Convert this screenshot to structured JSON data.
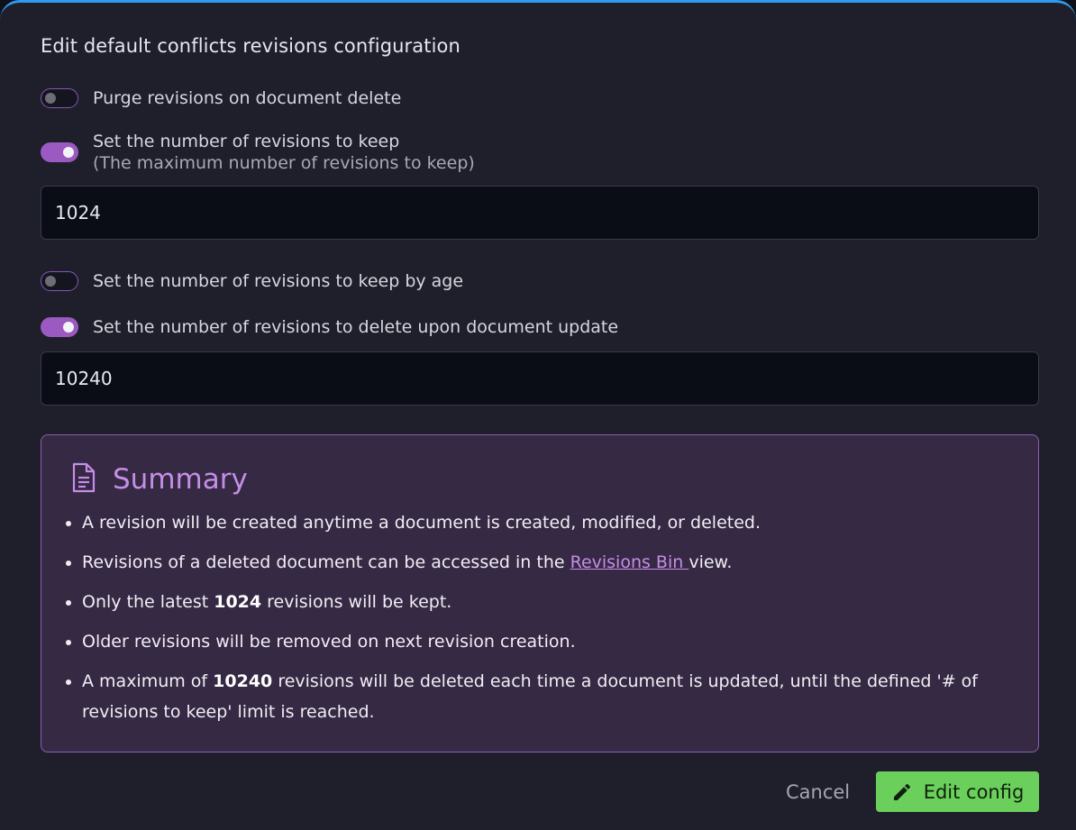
{
  "dialog": {
    "title": "Edit default conflicts revisions configuration"
  },
  "options": {
    "purge_on_delete": {
      "label": "Purge revisions on document delete",
      "enabled": false
    },
    "keep_count": {
      "label": "Set the number of revisions to keep",
      "sublabel": "(The maximum number of revisions to keep)",
      "enabled": true,
      "value": "1024"
    },
    "keep_by_age": {
      "label": "Set the number of revisions to keep by age",
      "enabled": false
    },
    "delete_on_update": {
      "label": "Set the number of revisions to delete upon document update",
      "enabled": true,
      "value": "10240"
    }
  },
  "summary": {
    "title": "Summary",
    "icon": "document-icon",
    "item1": "A revision will be created anytime a document is created, modified, or deleted.",
    "item2_before": "Revisions of a deleted document can be accessed in the ",
    "item2_link": "Revisions Bin ",
    "item2_after": "view.",
    "item3_before": "Only the latest ",
    "item3_value": "1024",
    "item3_after": " revisions will be kept.",
    "item4": "Older revisions will be removed on next revision creation.",
    "item5_before": "A maximum of ",
    "item5_value": "10240",
    "item5_after": " revisions will be deleted each time a document is updated, until the defined '# of revisions to keep' limit is reached."
  },
  "footer": {
    "cancel_label": "Cancel",
    "edit_label": "Edit config",
    "edit_icon": "pencil-icon"
  },
  "colors": {
    "accent": "#9b59c2",
    "top_border": "#2f9bf0",
    "summary_bg": "#362944",
    "primary_button": "#6ad05b"
  }
}
